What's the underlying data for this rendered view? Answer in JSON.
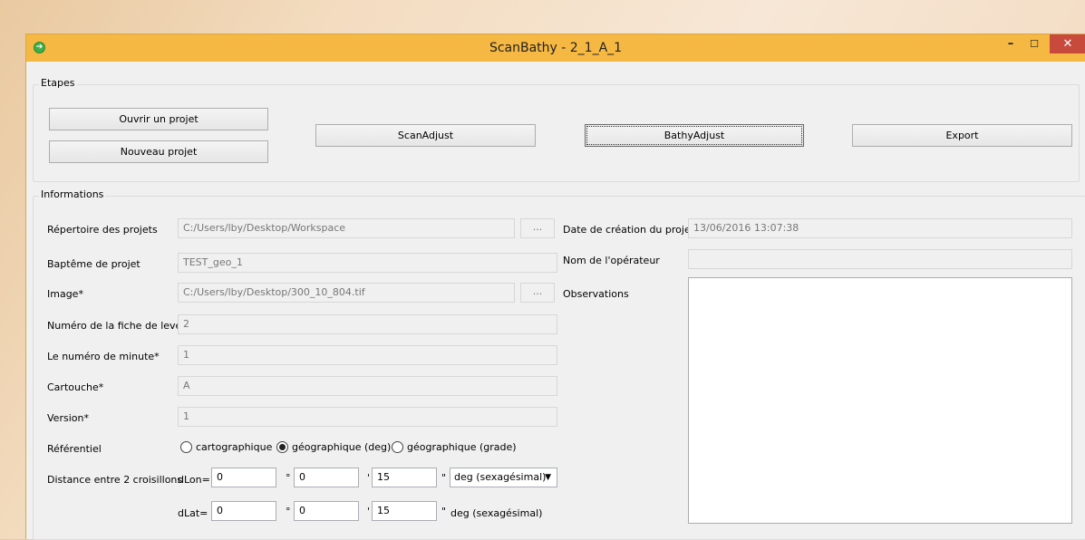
{
  "window": {
    "title": "ScanBathy - 2_1_A_1",
    "controls": {
      "minimize": "–",
      "maximize": "☐",
      "close": "✕"
    }
  },
  "etapes": {
    "legend": "Etapes",
    "open_project": "Ouvrir un projet",
    "new_project": "Nouveau projet",
    "scanadjust": "ScanAdjust",
    "bathyadjust": "BathyAdjust",
    "export": "Export"
  },
  "info": {
    "legend": "Informations",
    "repertoire_label": "Répertoire des projets",
    "repertoire_value": "C:/Users/lby/Desktop/Workspace",
    "bapteme_label": "Baptême de projet",
    "bapteme_value": "TEST_geo_1",
    "image_label": "Image*",
    "image_value": "C:/Users/lby/Desktop/300_10_804.tif",
    "browse": "...",
    "fiche_label": "Numéro de la fiche de levé*",
    "fiche_value": "2",
    "minute_label": "Le numéro de minute*",
    "minute_value": "1",
    "cartouche_label": "Cartouche*",
    "cartouche_value": "A",
    "version_label": "Version*",
    "version_value": "1",
    "referentiel_label": "Référentiel",
    "ref_options": [
      "cartographique",
      "géographique (deg)",
      "géographique (grade)"
    ],
    "ref_selected": "géographique (deg)",
    "distance_label": "Distance entre 2 croisillons",
    "dlon_label": "dLon=",
    "dlat_label": "dLat=",
    "dlon": [
      "0",
      "0",
      "15"
    ],
    "dlat": [
      "0",
      "0",
      "15"
    ],
    "deg_sym": "°",
    "min_sym": "'",
    "sec_sym": "\"",
    "dlon_unit": "deg (sexagésimal)",
    "dlat_unit": "deg (sexagésimal)",
    "date_label": "Date de création du projet",
    "date_value": "13/06/2016 13:07:38",
    "operateur_label": "Nom de l'opérateur",
    "operateur_value": "",
    "observations_label": "Observations",
    "observations_value": ""
  }
}
